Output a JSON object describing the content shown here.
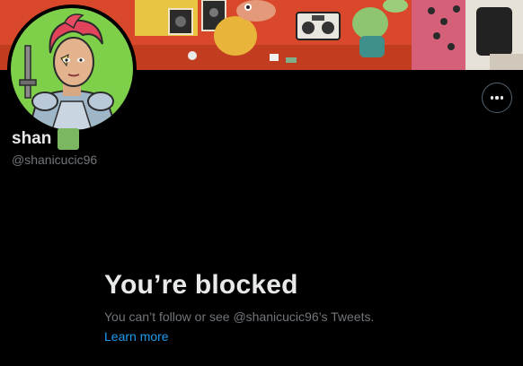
{
  "profile": {
    "display_name": "shan",
    "handle": "@shanicucic96",
    "more_button_label": "More"
  },
  "blocked": {
    "title": "You’re blocked",
    "description": "You can’t follow or see @shanicucic96’s Tweets.",
    "learn_more": "Learn more"
  },
  "colors": {
    "background": "#000000",
    "primary_text": "#e7e9ea",
    "secondary_text": "#71767b",
    "link": "#1d9bf0",
    "name_badge": "#7bb661"
  },
  "icons": {
    "more": "more-horizontal-icon"
  }
}
